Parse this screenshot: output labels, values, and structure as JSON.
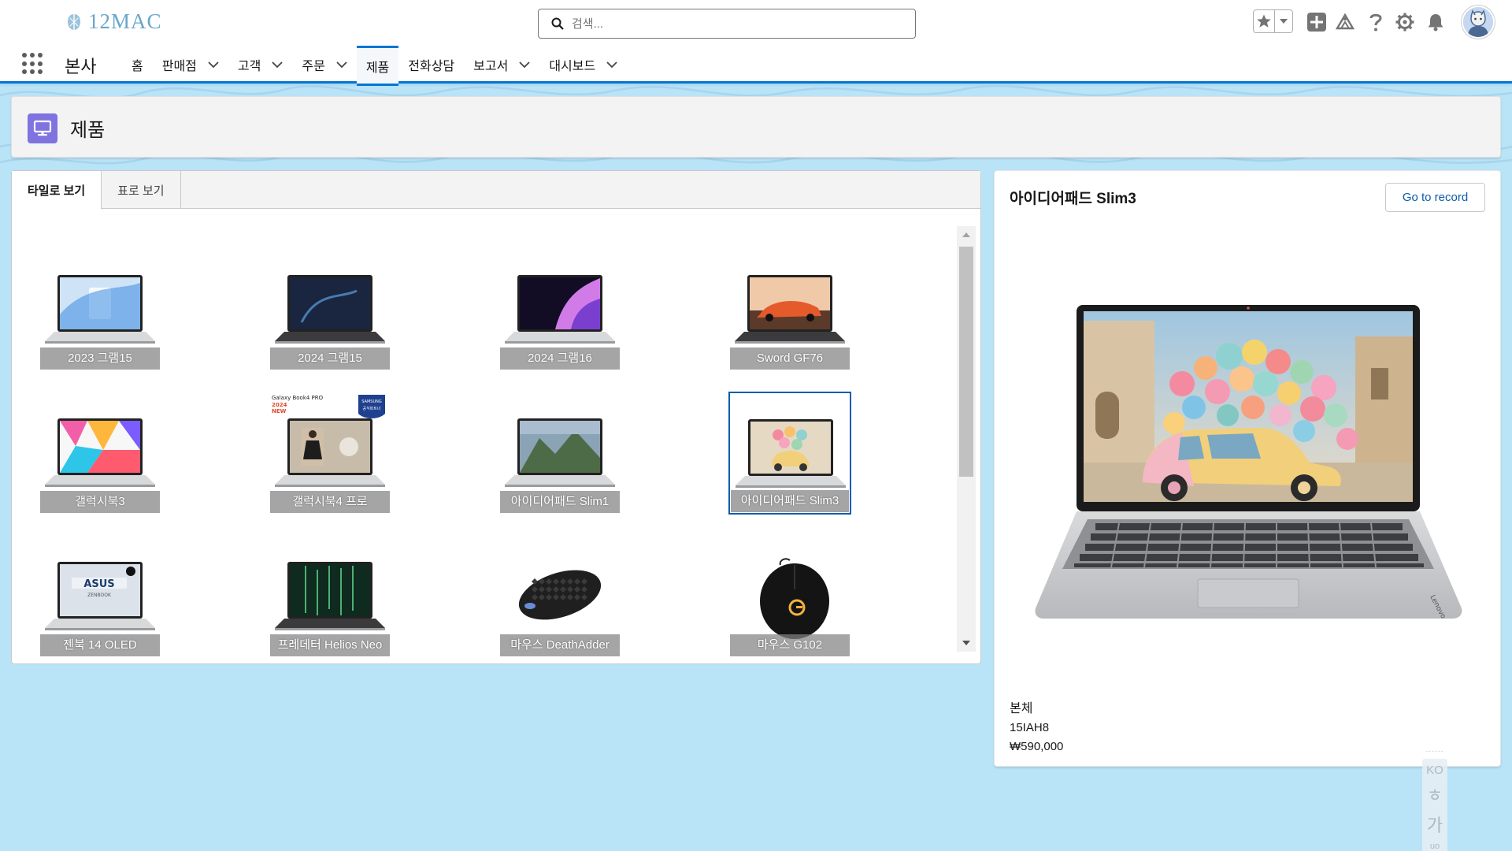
{
  "header": {
    "logo_text": "12MAC",
    "search_placeholder": "검색...",
    "app_name": "본사"
  },
  "nav": {
    "items": [
      {
        "label": "홈",
        "dropdown": false,
        "active": false
      },
      {
        "label": "판매점",
        "dropdown": true,
        "active": false
      },
      {
        "label": "고객",
        "dropdown": true,
        "active": false
      },
      {
        "label": "주문",
        "dropdown": true,
        "active": false
      },
      {
        "label": "제품",
        "dropdown": false,
        "active": true
      },
      {
        "label": "전화상담",
        "dropdown": false,
        "active": false
      },
      {
        "label": "보고서",
        "dropdown": true,
        "active": false
      },
      {
        "label": "대시보드",
        "dropdown": true,
        "active": false
      }
    ]
  },
  "page": {
    "title": "제품",
    "icon": "desktop-icon"
  },
  "tabs": [
    {
      "label": "타일로 보기",
      "active": true
    },
    {
      "label": "표로 보기",
      "active": false
    }
  ],
  "tiles": [
    {
      "name": "2023 그램15",
      "kind": "laptop-white"
    },
    {
      "name": "2024 그램15",
      "kind": "laptop-dark"
    },
    {
      "name": "2024 그램16",
      "kind": "laptop-purple"
    },
    {
      "name": "Sword GF76",
      "kind": "laptop-gaming"
    },
    {
      "name": "갤럭시북3",
      "kind": "laptop-colorful"
    },
    {
      "name": "갤럭시북4 프로",
      "kind": "laptop-galaxy4",
      "badge_text": "Galaxy Book4 PRO",
      "badge_year": "2024",
      "badge_new": "NEW",
      "badge_brand": "SAMSUNG",
      "badge_sub": "공식파트너"
    },
    {
      "name": "아이디어패드 Slim1",
      "kind": "laptop-mountain"
    },
    {
      "name": "아이디어패드 Slim3",
      "kind": "laptop-balloon",
      "selected": true
    },
    {
      "name": "젠북 14 OLED",
      "kind": "laptop-asus",
      "brand_text": "ASUS",
      "brand_sub": "ZENBOOK"
    },
    {
      "name": "프레데터 Helios Neo",
      "kind": "laptop-predator"
    },
    {
      "name": "마우스 DeathAdder",
      "kind": "mouse-black"
    },
    {
      "name": "마우스 G102",
      "kind": "mouse-logitech"
    }
  ],
  "detail": {
    "title": "아이디어패드 Slim3",
    "button_label": "Go to record",
    "category": "본체",
    "model": "15IAH8",
    "price": "₩590,000"
  },
  "lang_widget": {
    "dots": "......",
    "code": "KO",
    "glyph_1": "ㅎ",
    "glyph_2": "가",
    "bottom": "uo"
  },
  "colors": {
    "brand_blue": "#0176d3",
    "page_icon_bg": "#7f73e1",
    "background": "#b9e3f7",
    "tile_label_bg": "#828282"
  }
}
